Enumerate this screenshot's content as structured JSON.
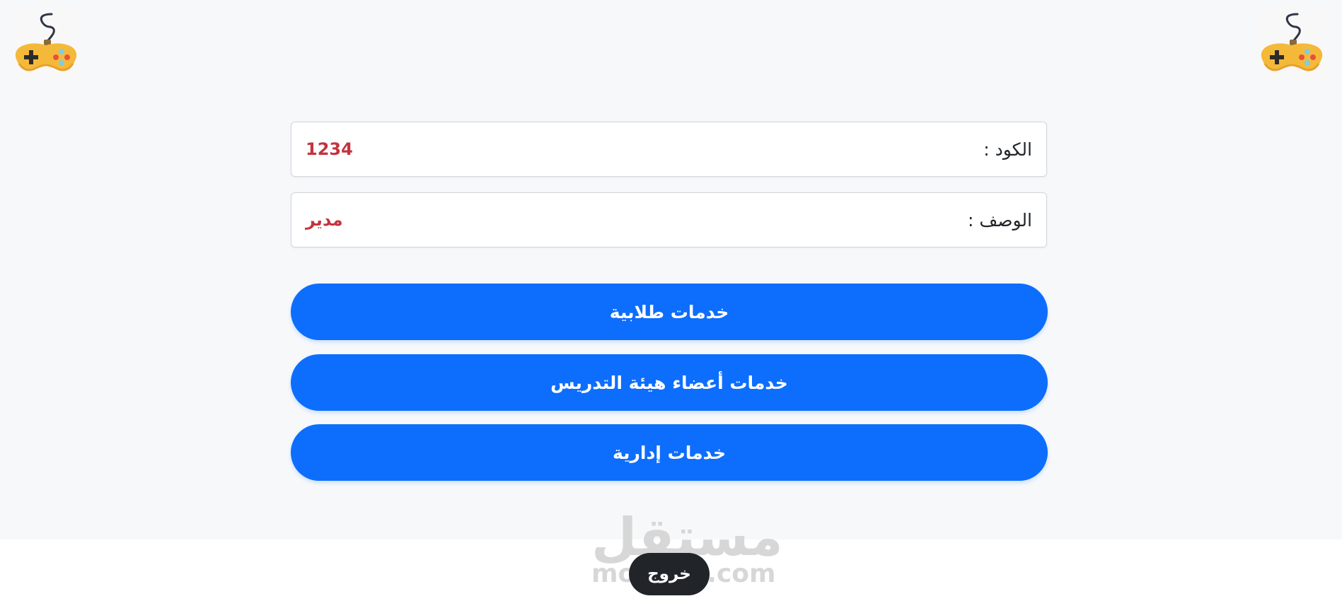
{
  "logos": {
    "left_icon": "gamepad-icon",
    "right_icon": "gamepad-icon"
  },
  "info": {
    "code_label": "الكود :",
    "code_value": "1234",
    "desc_label": "الوصف :",
    "desc_value": "مدير"
  },
  "buttons": {
    "student_services": "خدمات طلابية",
    "faculty_services": "خدمات أعضاء هيئة التدريس",
    "admin_services": "خدمات إدارية"
  },
  "footer": {
    "logout": "خروج"
  },
  "watermark": {
    "arabic": "مستقل",
    "latin": "mostaql.com"
  },
  "colors": {
    "primary": "#0d6efd",
    "value_red": "#c3343e",
    "dark": "#212529",
    "background": "#f7f8fa"
  }
}
